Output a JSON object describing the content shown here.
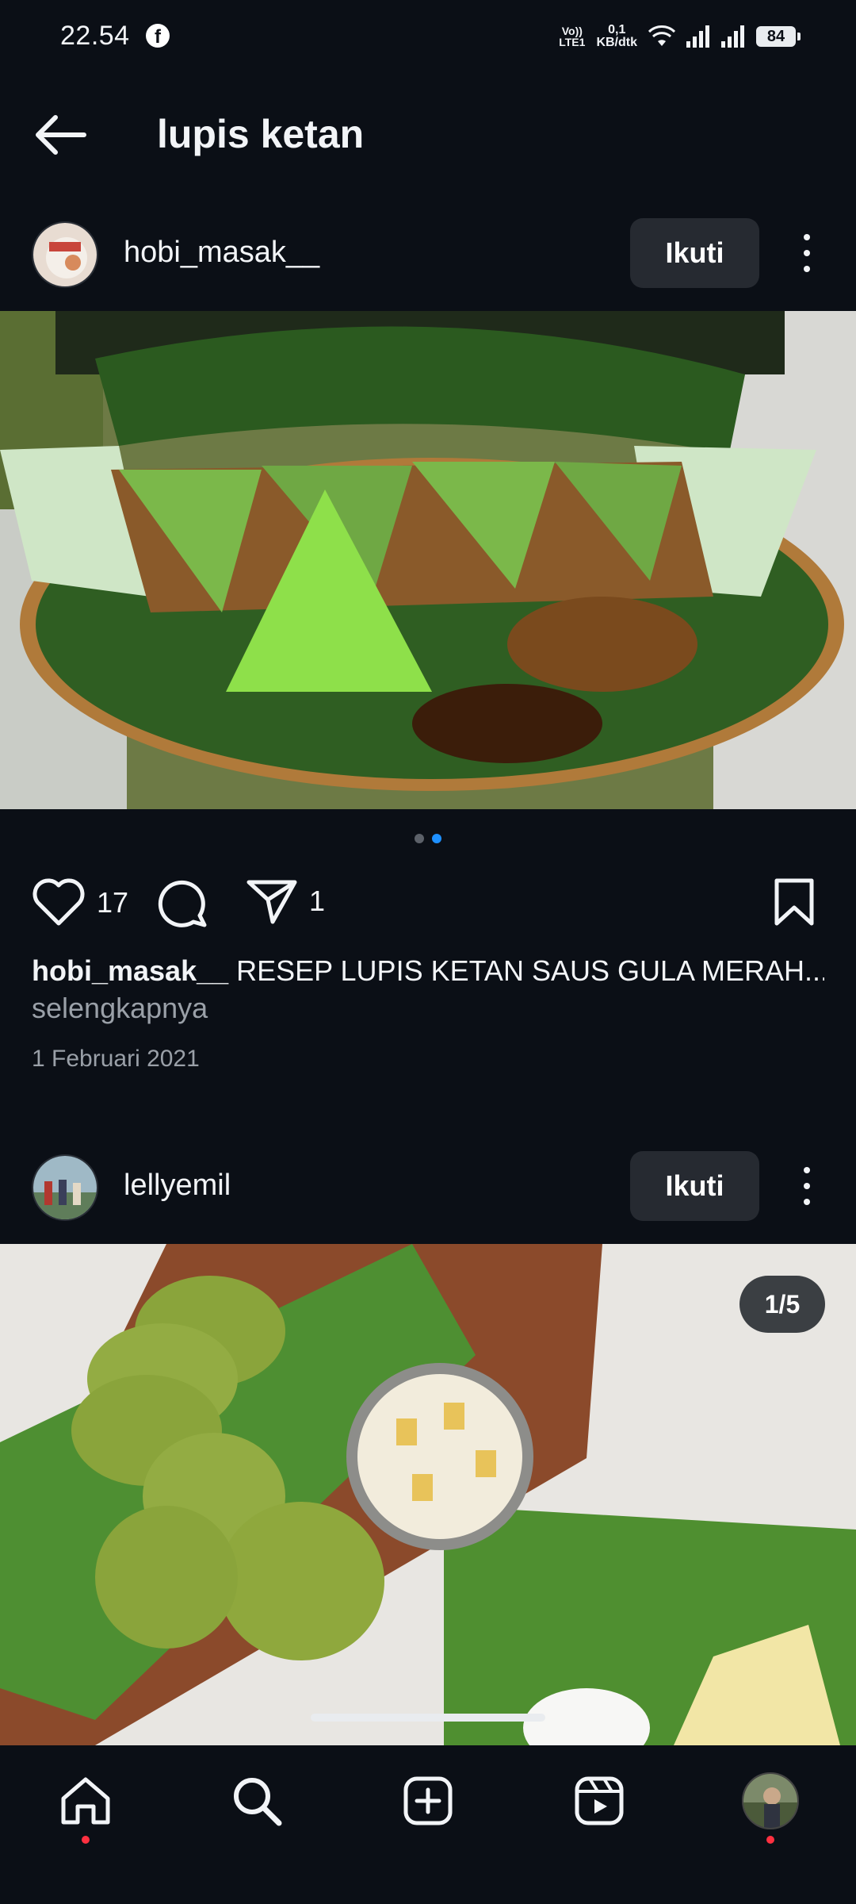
{
  "status_bar": {
    "time": "22.54",
    "volte_line1": "Vo))",
    "volte_line2": "LTE1",
    "speed_line1": "0,1",
    "speed_line2": "KB/dtk",
    "battery": "84"
  },
  "header": {
    "title": "lupis ketan"
  },
  "posts": [
    {
      "username": "hobi_masak__",
      "follow_label": "Ikuti",
      "likes": "17",
      "shares": "1",
      "caption_user": "hobi_masak__",
      "caption_text": " RESEP LUPIS KETAN SAUS GULA MERAH...",
      "more_label": "selengkapnya",
      "date": "1 Februari 2021",
      "carousel": {
        "count": 2,
        "active_index": 1
      }
    },
    {
      "username": "lellyemil",
      "follow_label": "Ikuti",
      "counter": "1/5"
    }
  ],
  "colors": {
    "background": "#0b0f16",
    "button": "#262a31",
    "accent_dot": "#1e90ff",
    "notification": "#ff3040"
  },
  "icons": {
    "nav": [
      "home-icon",
      "search-icon",
      "create-icon",
      "reels-icon",
      "profile-avatar"
    ]
  }
}
